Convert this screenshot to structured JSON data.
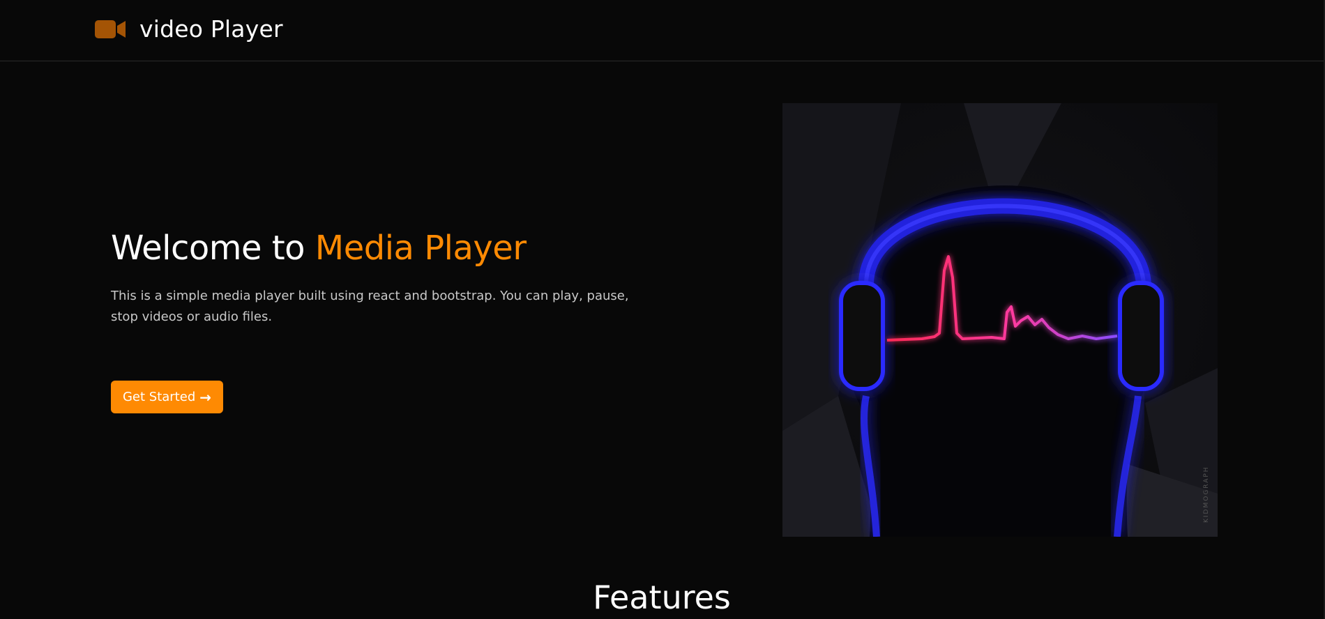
{
  "navbar": {
    "brand_label": "video Player",
    "brand_icon": "video-camera-icon"
  },
  "hero": {
    "title_prefix": "Welcome to",
    "title_accent": "Media Player",
    "description": "This is a simple media player built using react and bootstrap. You can play, pause, stop videos or audio files.",
    "cta_label": "Get Started",
    "cta_icon": "arrow-right-icon",
    "image_subject": "headphones-sound-wave-illustration",
    "image_signature": "KIDMOGRAPH"
  },
  "features": {
    "title": "Features"
  },
  "colors": {
    "background": "#080808",
    "accent": "#fe8a03",
    "brand_icon": "#a45405",
    "headphone_glow": "#2b2bff",
    "wave_start": "#ff2a55",
    "wave_end": "#8a4dff"
  }
}
